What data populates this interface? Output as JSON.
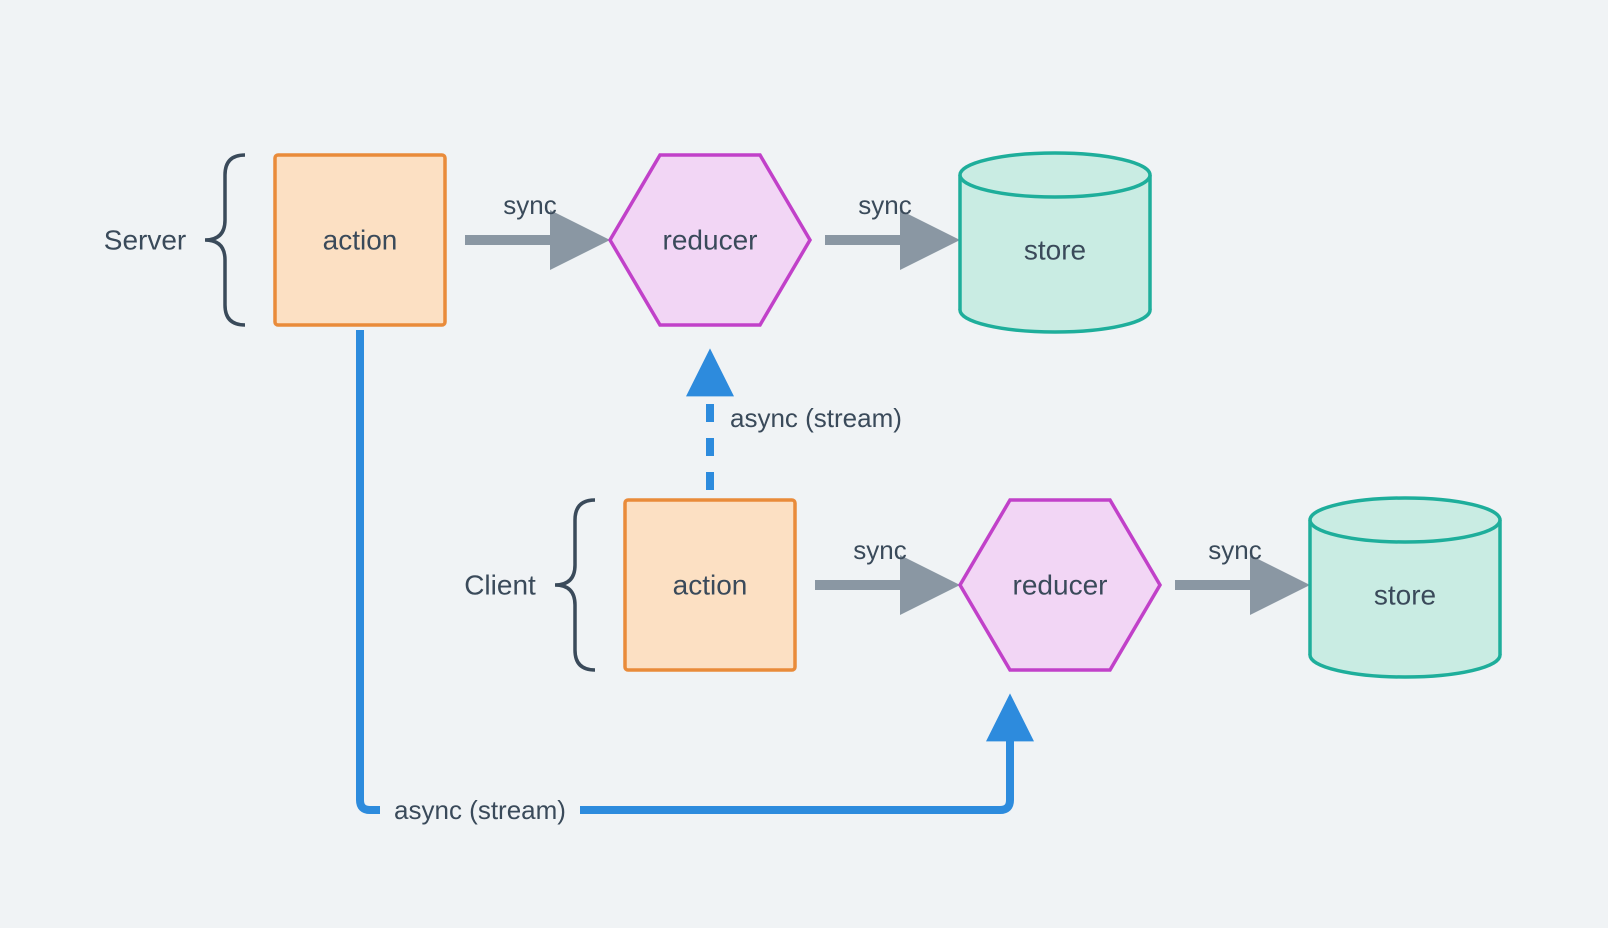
{
  "colors": {
    "bg": "#f0f3f5",
    "text": "#3a4a5a",
    "action_fill": "#fce0c3",
    "action_stroke": "#e98b3a",
    "reducer_fill": "#f2d6f5",
    "reducer_stroke": "#c141c9",
    "store_fill": "#c9ece3",
    "store_stroke": "#1eae9b",
    "arrow_gray": "#8a97a3",
    "arrow_blue": "#2d8bdd",
    "brace": "#3a4a5a"
  },
  "labels": {
    "server": "Server",
    "client": "Client",
    "action": "action",
    "reducer": "reducer",
    "store": "store"
  },
  "edges": {
    "sync": "sync",
    "async_stream": "async (stream)"
  }
}
